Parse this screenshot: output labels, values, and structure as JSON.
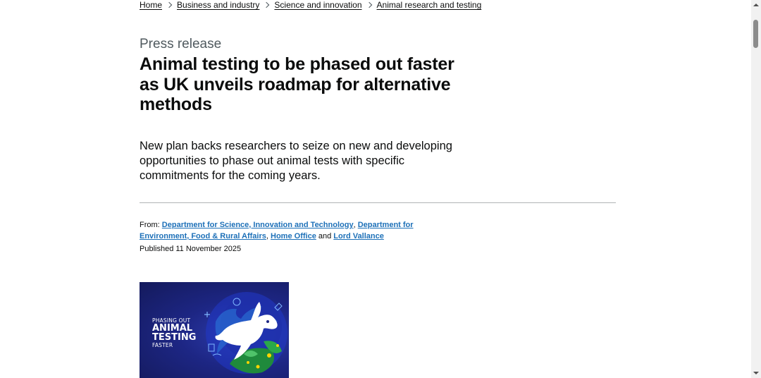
{
  "breadcrumbs": [
    {
      "label": "Home"
    },
    {
      "label": "Business and industry"
    },
    {
      "label": "Science and innovation"
    },
    {
      "label": "Animal research and testing"
    }
  ],
  "header": {
    "caption": "Press release",
    "title": "Animal testing to be phased out faster as UK unveils roadmap for alternative methods"
  },
  "lede": "New plan backs researchers to seize on new and developing opportunities to phase out animal tests with specific commitments for the coming years.",
  "meta": {
    "from_label": "From:",
    "orgs": [
      "Department for Science, Innovation and Technology",
      "Department for Environment, Food & Rural Affairs",
      "Home Office",
      "Lord Vallance"
    ],
    "separator": ",",
    "and_word": "and",
    "published": "Published 11 November 2025"
  },
  "hero_image": {
    "line1": "PHASING OUT",
    "line2": "ANIMAL",
    "line3": "TESTING",
    "line4": "FASTER"
  },
  "colors": {
    "link": "#1d70b8",
    "text": "#0b0c0c",
    "secondary_text": "#505a5f",
    "divider": "#b1b4b6",
    "hero_background": "#1d2684"
  }
}
